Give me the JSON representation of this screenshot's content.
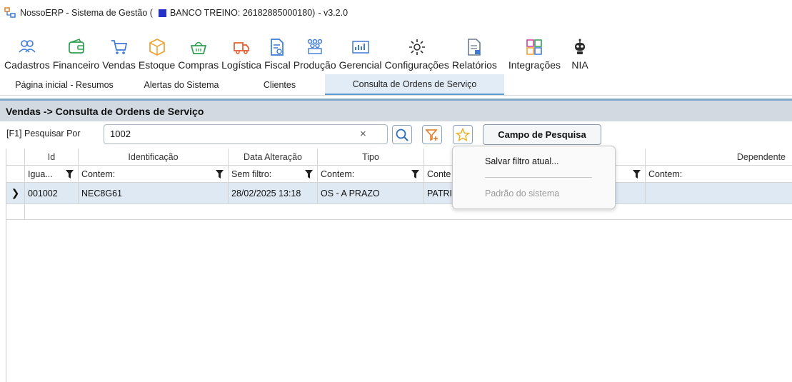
{
  "title_bar": {
    "prefix": "NossoERP - Sistema de Gestão (",
    "database": "BANCO TREINO: 26182885000180)",
    "version": "- v3.2.0"
  },
  "ribbon": {
    "items": [
      {
        "label": "Cadastros",
        "icon": "users-icon",
        "color": "#3c7ad6"
      },
      {
        "label": "Financeiro",
        "icon": "wallet-icon",
        "color": "#2e9e4f"
      },
      {
        "label": "Vendas",
        "icon": "cart-icon",
        "color": "#3c7ad6"
      },
      {
        "label": "Estoque",
        "icon": "box-icon",
        "color": "#f0a030"
      },
      {
        "label": "Compras",
        "icon": "basket-icon",
        "color": "#2e9e4f"
      },
      {
        "label": "Logística",
        "icon": "truck-icon",
        "color": "#e65a2a"
      },
      {
        "label": "Fiscal",
        "icon": "document-icon",
        "color": "#3c7ad6"
      },
      {
        "label": "Produção",
        "icon": "factory-icon",
        "color": "#3c7ad6"
      },
      {
        "label": "Gerencial",
        "icon": "chart-icon",
        "color": "#3c7ad6"
      },
      {
        "label": "Configurações",
        "icon": "gear-icon",
        "color": "#333333"
      },
      {
        "label": "Relatórios",
        "icon": "report-icon",
        "color": "#6b7b8c"
      },
      {
        "label": "Integrações",
        "icon": "puzzle-icon",
        "color": "#cc3fa0"
      },
      {
        "label": "NIA",
        "icon": "robot-icon",
        "color": "#333333"
      }
    ]
  },
  "tabs": [
    {
      "label": "Página inicial - Resumos",
      "active": false
    },
    {
      "label": "Alertas do Sistema",
      "active": false
    },
    {
      "label": "Clientes",
      "active": false
    },
    {
      "label": "Consulta de Ordens de Serviço",
      "active": true
    }
  ],
  "section": {
    "title": "Vendas -> Consulta de Ordens de Serviço"
  },
  "search": {
    "label": "[F1] Pesquisar Por",
    "value": "1002",
    "clear": "×",
    "campo_button": "Campo de Pesquisa"
  },
  "grid": {
    "columns": [
      "Id",
      "Identificação",
      "Data Alteração",
      "Tipo",
      "",
      "Dependente"
    ],
    "filters": [
      "Igua...",
      "Contem:",
      "Sem filtro:",
      "Contem:",
      "Conte",
      "Contem:"
    ],
    "rows": [
      {
        "id": "001002",
        "identificacao": "NEC8G61",
        "data": "28/02/2025 13:18",
        "tipo": "OS - A PRAZO",
        "col5": "PATRI",
        "dependente": ""
      }
    ]
  },
  "popup": {
    "item_save": "Salvar filtro atual...",
    "item_default": "Padrão do sistema"
  }
}
